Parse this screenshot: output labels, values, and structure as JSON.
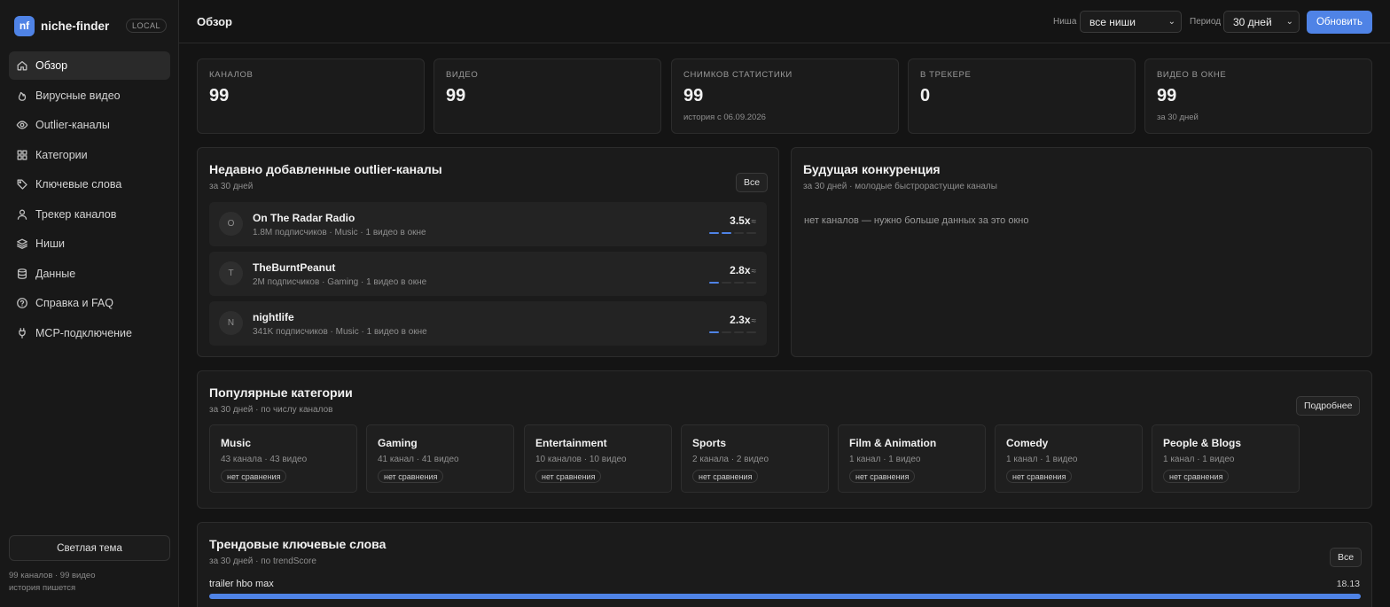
{
  "app": {
    "logo_text": "nf",
    "name": "niche-finder",
    "badge": "LOCAL"
  },
  "sidebar": {
    "items": [
      {
        "label": "Обзор",
        "icon": "home-icon",
        "active": true
      },
      {
        "label": "Вирусные видео",
        "icon": "flame-icon",
        "active": false
      },
      {
        "label": "Outlier-каналы",
        "icon": "eye-icon",
        "active": false
      },
      {
        "label": "Категории",
        "icon": "grid-icon",
        "active": false
      },
      {
        "label": "Ключевые слова",
        "icon": "tag-icon",
        "active": false
      },
      {
        "label": "Трекер каналов",
        "icon": "user-icon",
        "active": false
      },
      {
        "label": "Ниши",
        "icon": "layers-icon",
        "active": false
      },
      {
        "label": "Данные",
        "icon": "database-icon",
        "active": false
      },
      {
        "label": "Справка и FAQ",
        "icon": "help-circle-icon",
        "active": false
      },
      {
        "label": "MCP-подключение",
        "icon": "plug-icon",
        "active": false
      }
    ],
    "theme_button": "Светлая тема",
    "footer_line1": "99 каналов · 99 видео",
    "footer_line2": "история пишется"
  },
  "header": {
    "title": "Обзор",
    "niche_label": "Ниша",
    "niche_value": "все ниши",
    "period_label": "Период",
    "period_value": "30 дней",
    "refresh_button": "Обновить"
  },
  "stats": [
    {
      "label": "КАНАЛОВ",
      "value": "99",
      "sub": ""
    },
    {
      "label": "ВИДЕО",
      "value": "99",
      "sub": ""
    },
    {
      "label": "СНИМКОВ СТАТИСТИКИ",
      "value": "99",
      "sub": "история с 06.09.2026"
    },
    {
      "label": "В ТРЕКЕРЕ",
      "value": "0",
      "sub": ""
    },
    {
      "label": "ВИДЕО В ОКНЕ",
      "value": "99",
      "sub": "за 30 дней"
    }
  ],
  "outliers": {
    "title": "Недавно добавленные outlier-каналы",
    "subtitle": "за 30 дней",
    "button": "Все",
    "rows": [
      {
        "initial": "O",
        "name": "On The Radar Radio",
        "meta": "1.8M подписчиков · Music · 1 видео в окне",
        "score": "3.5x",
        "approx": "≈",
        "bars_filled": 2
      },
      {
        "initial": "T",
        "name": "TheBurntPeanut",
        "meta": "2M подписчиков · Gaming · 1 видео в окне",
        "score": "2.8x",
        "approx": "≈",
        "bars_filled": 1
      },
      {
        "initial": "N",
        "name": "nightlife",
        "meta": "341K подписчиков · Music · 1 видео в окне",
        "score": "2.3x",
        "approx": "≈",
        "bars_filled": 1
      }
    ]
  },
  "competition": {
    "title": "Будущая конкуренция",
    "subtitle": "за 30 дней · молодые быстрорастущие каналы",
    "empty": "нет каналов — нужно больше данных за это окно"
  },
  "categories": {
    "title": "Популярные категории",
    "subtitle": "за 30 дней · по числу каналов",
    "button": "Подробнее",
    "items": [
      {
        "name": "Music",
        "meta": "43 канала · 43 видео",
        "badge": "нет сравнения"
      },
      {
        "name": "Gaming",
        "meta": "41 канал · 41 видео",
        "badge": "нет сравнения"
      },
      {
        "name": "Entertainment",
        "meta": "10 каналов · 10 видео",
        "badge": "нет сравнения"
      },
      {
        "name": "Sports",
        "meta": "2 канала · 2 видео",
        "badge": "нет сравнения"
      },
      {
        "name": "Film & Animation",
        "meta": "1 канал · 1 видео",
        "badge": "нет сравнения"
      },
      {
        "name": "Comedy",
        "meta": "1 канал · 1 видео",
        "badge": "нет сравнения"
      },
      {
        "name": "People & Blogs",
        "meta": "1 канал · 1 видео",
        "badge": "нет сравнения"
      }
    ]
  },
  "keywords": {
    "title": "Трендовые ключевые слова",
    "subtitle": "за 30 дней · по trendScore",
    "button": "Все",
    "items": [
      {
        "keyword": "trailer hbo max",
        "score": "18.13",
        "fill_percent": 100
      }
    ]
  },
  "colors": {
    "accent": "#4f83e6",
    "background": "#141414",
    "card": "#1b1b1b"
  }
}
